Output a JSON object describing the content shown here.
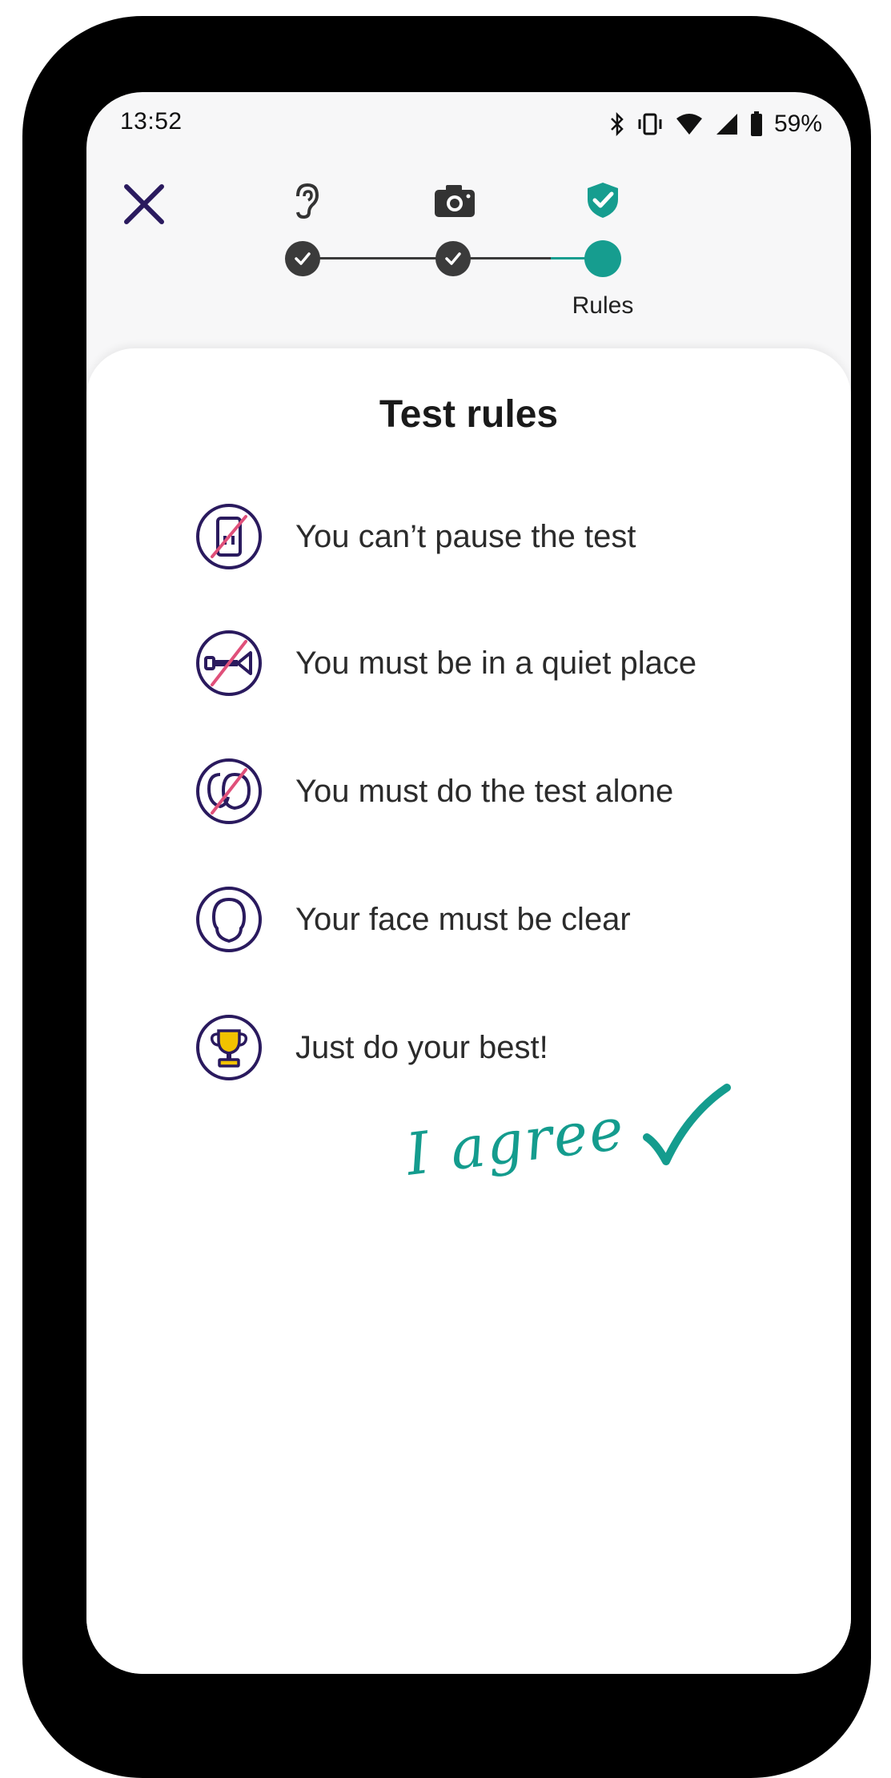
{
  "status_bar": {
    "time": "13:52",
    "battery": "59%",
    "icons": [
      "bluetooth-icon",
      "vibrate-icon",
      "wifi-icon",
      "signal-icon",
      "battery-icon"
    ]
  },
  "header": {
    "close_icon": "close-icon",
    "steps": [
      {
        "icon": "ear-icon",
        "state": "completed",
        "label": ""
      },
      {
        "icon": "camera-icon",
        "state": "completed",
        "label": ""
      },
      {
        "icon": "shield-check-icon",
        "state": "current",
        "label": "Rules"
      }
    ]
  },
  "main": {
    "title": "Test rules",
    "rules": [
      {
        "icon": "no-phone-icon",
        "text": "You can’t pause the test"
      },
      {
        "icon": "no-trumpet-icon",
        "text": "You must be in a quiet place"
      },
      {
        "icon": "no-people-icon",
        "text": "You must do the test alone"
      },
      {
        "icon": "face-icon",
        "text": "Your face must be clear"
      },
      {
        "icon": "trophy-icon",
        "text": "Just do your best!"
      }
    ],
    "agree_label": "I agree"
  },
  "colors": {
    "accent": "#169d8f",
    "brand_purple": "#2a1a5e",
    "strike": "#e0507a",
    "trophy": "#f2c200"
  }
}
